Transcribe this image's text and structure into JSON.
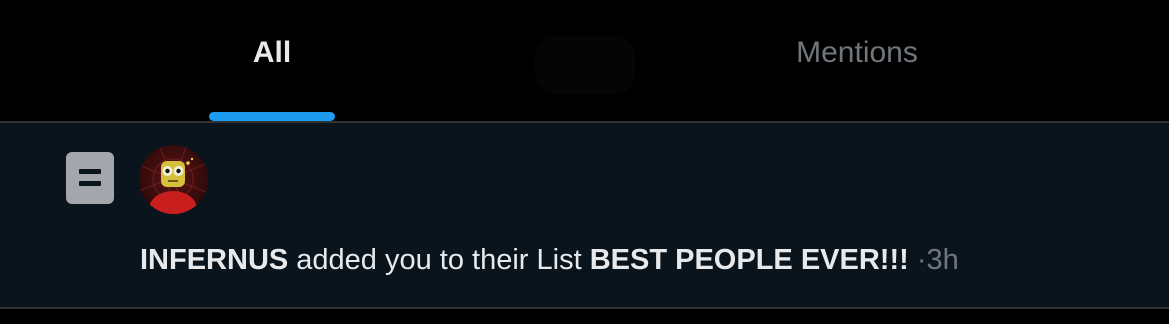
{
  "tabs": {
    "all_label": "All",
    "mentions_label": "Mentions"
  },
  "notification": {
    "icon": "list-icon",
    "actor": "INFERNUS",
    "action": "added you to their List",
    "list_name": "BEST PEOPLE EVER!!!",
    "separator": "·",
    "time": "3h"
  },
  "colors": {
    "accent": "#1d9bf0",
    "background": "#000000",
    "row_background": "#0a141d",
    "text_primary": "#e7e9ea",
    "text_secondary": "#71767b"
  }
}
